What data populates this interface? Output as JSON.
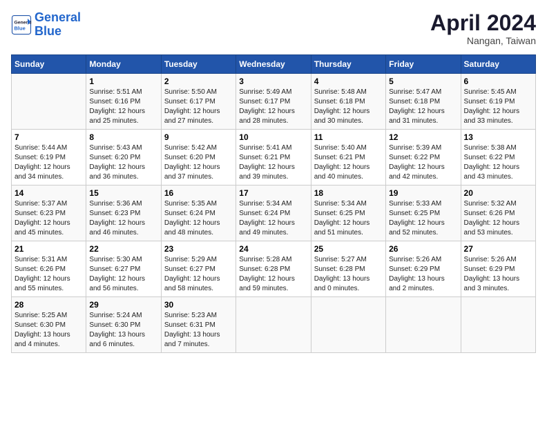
{
  "header": {
    "logo_line1": "General",
    "logo_line2": "Blue",
    "month": "April 2024",
    "location": "Nangan, Taiwan"
  },
  "weekdays": [
    "Sunday",
    "Monday",
    "Tuesday",
    "Wednesday",
    "Thursday",
    "Friday",
    "Saturday"
  ],
  "weeks": [
    [
      {
        "day": "",
        "info": ""
      },
      {
        "day": "1",
        "info": "Sunrise: 5:51 AM\nSunset: 6:16 PM\nDaylight: 12 hours\nand 25 minutes."
      },
      {
        "day": "2",
        "info": "Sunrise: 5:50 AM\nSunset: 6:17 PM\nDaylight: 12 hours\nand 27 minutes."
      },
      {
        "day": "3",
        "info": "Sunrise: 5:49 AM\nSunset: 6:17 PM\nDaylight: 12 hours\nand 28 minutes."
      },
      {
        "day": "4",
        "info": "Sunrise: 5:48 AM\nSunset: 6:18 PM\nDaylight: 12 hours\nand 30 minutes."
      },
      {
        "day": "5",
        "info": "Sunrise: 5:47 AM\nSunset: 6:18 PM\nDaylight: 12 hours\nand 31 minutes."
      },
      {
        "day": "6",
        "info": "Sunrise: 5:45 AM\nSunset: 6:19 PM\nDaylight: 12 hours\nand 33 minutes."
      }
    ],
    [
      {
        "day": "7",
        "info": "Sunrise: 5:44 AM\nSunset: 6:19 PM\nDaylight: 12 hours\nand 34 minutes."
      },
      {
        "day": "8",
        "info": "Sunrise: 5:43 AM\nSunset: 6:20 PM\nDaylight: 12 hours\nand 36 minutes."
      },
      {
        "day": "9",
        "info": "Sunrise: 5:42 AM\nSunset: 6:20 PM\nDaylight: 12 hours\nand 37 minutes."
      },
      {
        "day": "10",
        "info": "Sunrise: 5:41 AM\nSunset: 6:21 PM\nDaylight: 12 hours\nand 39 minutes."
      },
      {
        "day": "11",
        "info": "Sunrise: 5:40 AM\nSunset: 6:21 PM\nDaylight: 12 hours\nand 40 minutes."
      },
      {
        "day": "12",
        "info": "Sunrise: 5:39 AM\nSunset: 6:22 PM\nDaylight: 12 hours\nand 42 minutes."
      },
      {
        "day": "13",
        "info": "Sunrise: 5:38 AM\nSunset: 6:22 PM\nDaylight: 12 hours\nand 43 minutes."
      }
    ],
    [
      {
        "day": "14",
        "info": "Sunrise: 5:37 AM\nSunset: 6:23 PM\nDaylight: 12 hours\nand 45 minutes."
      },
      {
        "day": "15",
        "info": "Sunrise: 5:36 AM\nSunset: 6:23 PM\nDaylight: 12 hours\nand 46 minutes."
      },
      {
        "day": "16",
        "info": "Sunrise: 5:35 AM\nSunset: 6:24 PM\nDaylight: 12 hours\nand 48 minutes."
      },
      {
        "day": "17",
        "info": "Sunrise: 5:34 AM\nSunset: 6:24 PM\nDaylight: 12 hours\nand 49 minutes."
      },
      {
        "day": "18",
        "info": "Sunrise: 5:34 AM\nSunset: 6:25 PM\nDaylight: 12 hours\nand 51 minutes."
      },
      {
        "day": "19",
        "info": "Sunrise: 5:33 AM\nSunset: 6:25 PM\nDaylight: 12 hours\nand 52 minutes."
      },
      {
        "day": "20",
        "info": "Sunrise: 5:32 AM\nSunset: 6:26 PM\nDaylight: 12 hours\nand 53 minutes."
      }
    ],
    [
      {
        "day": "21",
        "info": "Sunrise: 5:31 AM\nSunset: 6:26 PM\nDaylight: 12 hours\nand 55 minutes."
      },
      {
        "day": "22",
        "info": "Sunrise: 5:30 AM\nSunset: 6:27 PM\nDaylight: 12 hours\nand 56 minutes."
      },
      {
        "day": "23",
        "info": "Sunrise: 5:29 AM\nSunset: 6:27 PM\nDaylight: 12 hours\nand 58 minutes."
      },
      {
        "day": "24",
        "info": "Sunrise: 5:28 AM\nSunset: 6:28 PM\nDaylight: 12 hours\nand 59 minutes."
      },
      {
        "day": "25",
        "info": "Sunrise: 5:27 AM\nSunset: 6:28 PM\nDaylight: 13 hours\nand 0 minutes."
      },
      {
        "day": "26",
        "info": "Sunrise: 5:26 AM\nSunset: 6:29 PM\nDaylight: 13 hours\nand 2 minutes."
      },
      {
        "day": "27",
        "info": "Sunrise: 5:26 AM\nSunset: 6:29 PM\nDaylight: 13 hours\nand 3 minutes."
      }
    ],
    [
      {
        "day": "28",
        "info": "Sunrise: 5:25 AM\nSunset: 6:30 PM\nDaylight: 13 hours\nand 4 minutes."
      },
      {
        "day": "29",
        "info": "Sunrise: 5:24 AM\nSunset: 6:30 PM\nDaylight: 13 hours\nand 6 minutes."
      },
      {
        "day": "30",
        "info": "Sunrise: 5:23 AM\nSunset: 6:31 PM\nDaylight: 13 hours\nand 7 minutes."
      },
      {
        "day": "",
        "info": ""
      },
      {
        "day": "",
        "info": ""
      },
      {
        "day": "",
        "info": ""
      },
      {
        "day": "",
        "info": ""
      }
    ]
  ]
}
